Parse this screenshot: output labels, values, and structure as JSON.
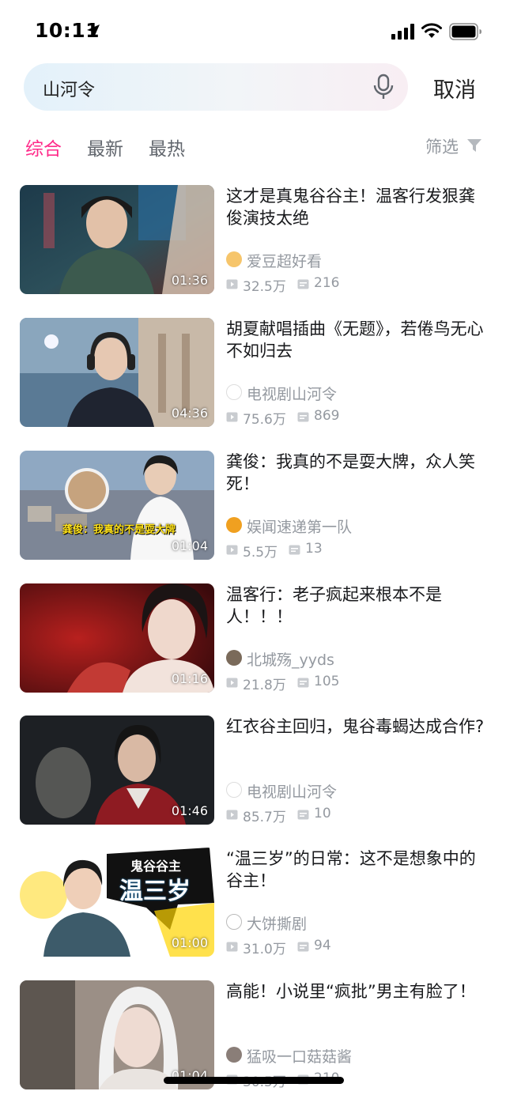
{
  "status_bar": {
    "time": "10:11"
  },
  "search": {
    "query": "山河令",
    "cancel_label": "取消"
  },
  "tabs": [
    {
      "label": "综合",
      "active": true
    },
    {
      "label": "最新",
      "active": false
    },
    {
      "label": "最热",
      "active": false
    }
  ],
  "filter_label": "筛选",
  "colors": {
    "accent": "#ff2b8a",
    "muted": "#9499a0"
  },
  "videos": [
    {
      "title": "这才是真鬼谷谷主！温客行发狠龚俊演技太绝",
      "author": "爱豆超好看",
      "views": "32.5万",
      "danmaku": "216",
      "duration": "01:36"
    },
    {
      "title": "胡夏献唱插曲《无题》，若倦鸟无心不如归去",
      "author": "电视剧山河令",
      "views": "75.6万",
      "danmaku": "869",
      "duration": "04:36"
    },
    {
      "title": "龚俊：我真的不是耍大牌，众人笑死！",
      "author": "娱闻速递第一队",
      "views": "5.5万",
      "danmaku": "13",
      "duration": "01:04",
      "thumb_caption": "龚俊：我真的不是耍大牌"
    },
    {
      "title": "温客行：老子疯起来根本不是人！！！",
      "author": "北城殇_yyds",
      "views": "21.8万",
      "danmaku": "105",
      "duration": "01:16"
    },
    {
      "title": "红衣谷主回归，鬼谷毒蝎达成合作?",
      "author": "电视剧山河令",
      "views": "85.7万",
      "danmaku": "10",
      "duration": "01:46"
    },
    {
      "title": "“温三岁”的日常：这不是想象中的谷主！",
      "author": "大饼撕剧",
      "views": "31.0万",
      "danmaku": "94",
      "duration": "01:00",
      "thumb_caption_1": "鬼谷谷主",
      "thumb_caption_2": "温三岁"
    },
    {
      "title": "高能！小说里“疯批”男主有脸了！",
      "author": "猛吸一口菇菇酱",
      "views": "30.5万",
      "danmaku": "210",
      "duration": "01:04"
    }
  ]
}
